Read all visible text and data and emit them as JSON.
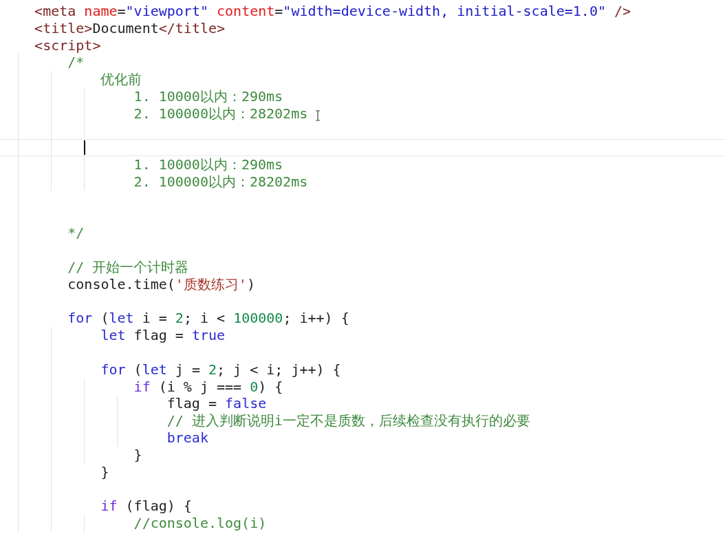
{
  "editor": {
    "lines": [
      {
        "current": false,
        "tokens": [
          {
            "kind": "tag",
            "text": "<meta "
          },
          {
            "kind": "attr",
            "text": "name"
          },
          {
            "kind": "plain",
            "text": "="
          },
          {
            "kind": "string",
            "text": "\"viewport\" "
          },
          {
            "kind": "attr",
            "text": "content"
          },
          {
            "kind": "plain",
            "text": "="
          },
          {
            "kind": "string",
            "text": "\"width=device-width, initial-scale=1.0\" "
          },
          {
            "kind": "tag",
            "text": "/>"
          }
        ]
      },
      {
        "current": false,
        "tokens": [
          {
            "kind": "tag",
            "text": "<title>"
          },
          {
            "kind": "plain",
            "text": "Document"
          },
          {
            "kind": "tag",
            "text": "</title>"
          }
        ]
      },
      {
        "current": false,
        "tokens": [
          {
            "kind": "tag",
            "text": "<script>"
          }
        ]
      },
      {
        "current": false,
        "tokens": [
          {
            "kind": "comment",
            "text": "    /*"
          }
        ]
      },
      {
        "current": false,
        "tokens": [
          {
            "kind": "comment",
            "text": "        优化前"
          }
        ]
      },
      {
        "current": false,
        "tokens": [
          {
            "kind": "comment",
            "text": "            1. 10000以内：290ms"
          }
        ]
      },
      {
        "current": false,
        "tokens": [
          {
            "kind": "comment",
            "text": "            2. 100000以内：28202ms"
          }
        ]
      },
      {
        "current": false
      },
      {
        "current": true
      },
      {
        "current": false,
        "tokens": [
          {
            "kind": "comment",
            "text": "            1. 10000以内：290ms"
          }
        ]
      },
      {
        "current": false,
        "tokens": [
          {
            "kind": "comment",
            "text": "            2. 100000以内：28202ms"
          }
        ]
      },
      {
        "current": false
      },
      {
        "current": false
      },
      {
        "current": false,
        "tokens": [
          {
            "kind": "comment",
            "text": "    */"
          }
        ]
      },
      {
        "current": false
      },
      {
        "current": false,
        "tokens": [
          {
            "kind": "comment",
            "text": "    // 开始一个计时器"
          }
        ]
      },
      {
        "current": false,
        "tokens": [
          {
            "kind": "plain",
            "text": "    console.time("
          },
          {
            "kind": "string2",
            "text": "'质数练习'"
          },
          {
            "kind": "plain",
            "text": ")"
          }
        ]
      },
      {
        "current": false
      },
      {
        "current": false,
        "tokens": [
          {
            "kind": "keyword",
            "text": "    for"
          },
          {
            "kind": "plain",
            "text": " ("
          },
          {
            "kind": "keyword",
            "text": "let"
          },
          {
            "kind": "plain",
            "text": " i = "
          },
          {
            "kind": "number",
            "text": "2"
          },
          {
            "kind": "plain",
            "text": "; i < "
          },
          {
            "kind": "number",
            "text": "100000"
          },
          {
            "kind": "plain",
            "text": "; i++) {"
          }
        ]
      },
      {
        "current": false,
        "tokens": [
          {
            "kind": "keyword",
            "text": "        let"
          },
          {
            "kind": "plain",
            "text": " flag = "
          },
          {
            "kind": "keyword",
            "text": "true"
          }
        ]
      },
      {
        "current": false
      },
      {
        "current": false,
        "tokens": [
          {
            "kind": "keyword",
            "text": "        for"
          },
          {
            "kind": "plain",
            "text": " ("
          },
          {
            "kind": "keyword",
            "text": "let"
          },
          {
            "kind": "plain",
            "text": " j = "
          },
          {
            "kind": "number",
            "text": "2"
          },
          {
            "kind": "plain",
            "text": "; j < i; j++) {"
          }
        ]
      },
      {
        "current": false,
        "tokens": [
          {
            "kind": "control",
            "text": "            if"
          },
          {
            "kind": "plain",
            "text": " (i % j === "
          },
          {
            "kind": "number",
            "text": "0"
          },
          {
            "kind": "plain",
            "text": ") {"
          }
        ]
      },
      {
        "current": false,
        "tokens": [
          {
            "kind": "plain",
            "text": "                flag = "
          },
          {
            "kind": "keyword",
            "text": "false"
          }
        ]
      },
      {
        "current": false,
        "tokens": [
          {
            "kind": "comment",
            "text": "                // 进入判断说明i一定不是质数，后续检查没有执行的必要"
          }
        ]
      },
      {
        "current": false,
        "tokens": [
          {
            "kind": "keyword",
            "text": "                break"
          }
        ]
      },
      {
        "current": false,
        "tokens": [
          {
            "kind": "plain",
            "text": "            }"
          }
        ]
      },
      {
        "current": false,
        "tokens": [
          {
            "kind": "plain",
            "text": "        }"
          }
        ]
      },
      {
        "current": false
      },
      {
        "current": false,
        "tokens": [
          {
            "kind": "control",
            "text": "        if"
          },
          {
            "kind": "plain",
            "text": " (flag) {"
          }
        ]
      },
      {
        "current": false,
        "tokens": [
          {
            "kind": "comment",
            "text": "            //console.log(i)"
          }
        ]
      }
    ]
  }
}
